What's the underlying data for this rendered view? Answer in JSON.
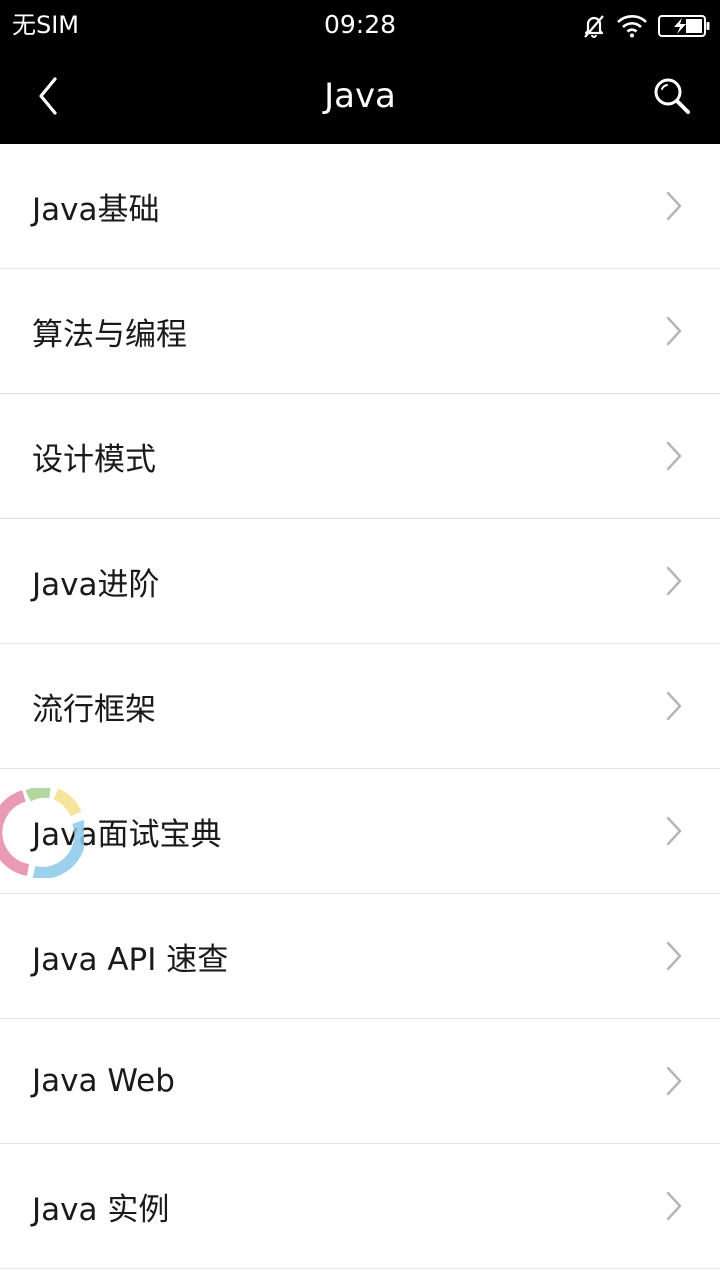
{
  "status_bar": {
    "carrier": "无SIM",
    "time": "09:28",
    "icons": [
      "mute-bell-icon",
      "wifi-icon",
      "battery-charging-icon"
    ]
  },
  "nav": {
    "title": "Java",
    "back_icon": "back-chevron-icon",
    "search_icon": "search-icon"
  },
  "list": {
    "items": [
      {
        "label": "Java基础"
      },
      {
        "label": "算法与编程"
      },
      {
        "label": "设计模式"
      },
      {
        "label": "Java进阶"
      },
      {
        "label": "流行框架"
      },
      {
        "label": "Java面试宝典"
      },
      {
        "label": "Java API 速查"
      },
      {
        "label": "Java Web"
      },
      {
        "label": "Java 实例"
      }
    ],
    "chevron_icon": "chevron-right-icon"
  },
  "colors": {
    "topbar": "#000000",
    "background": "#ffffff",
    "divider": "#e2e2e2",
    "chevron": "#b5b5b5",
    "loader_segments": [
      "#e58aa6",
      "#a9cf8f",
      "#f6df8a",
      "#8cc8ea"
    ]
  }
}
